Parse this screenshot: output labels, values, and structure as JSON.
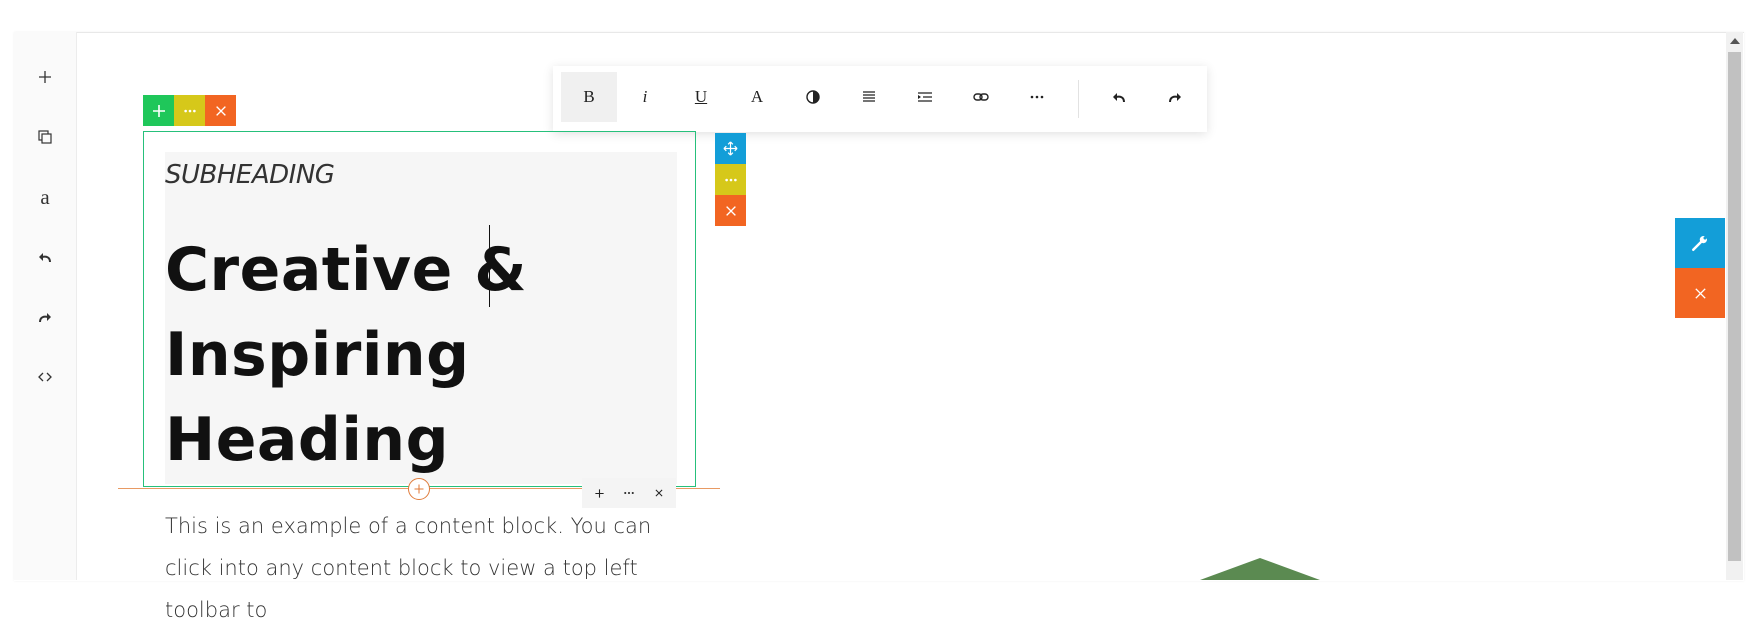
{
  "sidebar": {
    "items": [
      {
        "name": "add",
        "icon": "plus-icon"
      },
      {
        "name": "duplicate",
        "icon": "copy-icon"
      },
      {
        "name": "typography",
        "label": "a"
      },
      {
        "name": "undo",
        "icon": "undo-icon"
      },
      {
        "name": "redo",
        "icon": "redo-icon"
      },
      {
        "name": "html",
        "icon": "code-icon"
      }
    ]
  },
  "toolbar": {
    "bold": "B",
    "italic": "i",
    "underline": "U",
    "font": "A",
    "icons": [
      "contrast-icon",
      "align-icon",
      "indent-icon",
      "link-icon",
      "more-icon",
      "undo-icon",
      "redo-icon"
    ]
  },
  "content": {
    "subheading": "SUBHEADING",
    "heading": "Creative & Inspiring Heading",
    "paragraph": "This is an example of a content block.  You can click into any content block to view a top left toolbar to"
  },
  "colors": {
    "green": "#1fc75a",
    "yellow": "#d6c81a",
    "orange": "#f26522",
    "blue": "#139ed8",
    "outline": "#26c07b"
  }
}
